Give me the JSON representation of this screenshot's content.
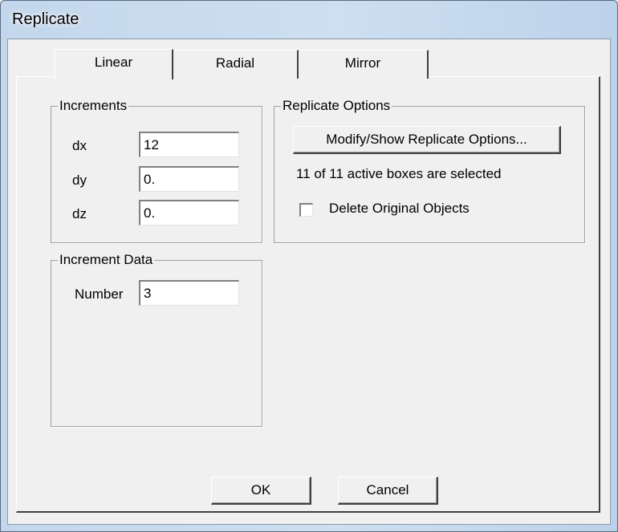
{
  "window": {
    "title": "Replicate"
  },
  "tabs": [
    {
      "label": "Linear",
      "active": true
    },
    {
      "label": "Radial",
      "active": false
    },
    {
      "label": "Mirror",
      "active": false
    }
  ],
  "increments": {
    "legend": "Increments",
    "dx": {
      "label": "dx",
      "value": "12"
    },
    "dy": {
      "label": "dy",
      "value": "0."
    },
    "dz": {
      "label": "dz",
      "value": "0."
    }
  },
  "replicate_options": {
    "legend": "Replicate Options",
    "button_label": "Modify/Show Replicate Options...",
    "status_text": "11 of 11 active boxes are selected",
    "delete_original_label": "Delete Original Objects",
    "delete_original_checked": false
  },
  "increment_data": {
    "legend": "Increment Data",
    "number_label": "Number",
    "number_value": "3"
  },
  "buttons": {
    "ok": "OK",
    "cancel": "Cancel"
  }
}
